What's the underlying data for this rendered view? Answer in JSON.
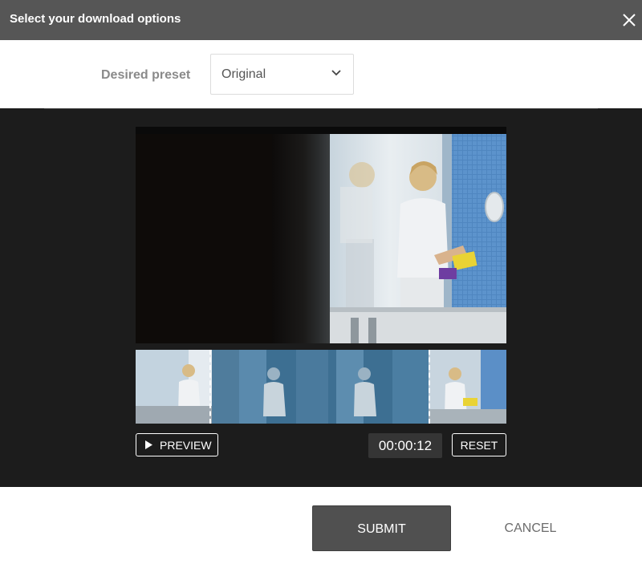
{
  "header": {
    "title": "Select your download options",
    "close_icon": "close-icon"
  },
  "preset": {
    "label": "Desired preset",
    "selected": "Original",
    "dropdown_icon": "chevron-down-icon"
  },
  "player": {
    "timecode": "00:00:12",
    "preview_label": "PREVIEW",
    "preview_icon": "play-icon",
    "reset_label": "RESET",
    "trim_start": 0.2,
    "trim_end": 0.79
  },
  "footer": {
    "submit_label": "SUBMIT",
    "cancel_label": "CANCEL"
  },
  "colors": {
    "header_bg": "#565656",
    "stage_bg": "#1c1c1c",
    "submit_bg": "#505050",
    "timeline_tint": "#2d5e7e"
  }
}
